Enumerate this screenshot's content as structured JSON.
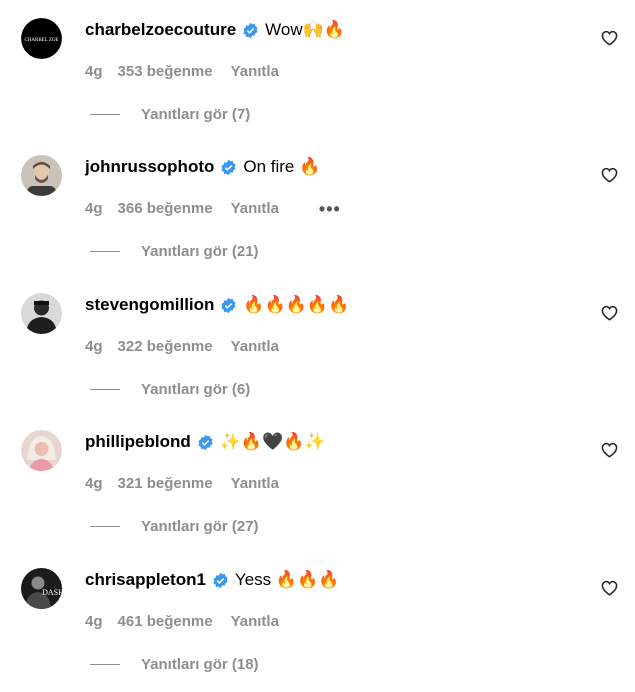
{
  "comments": [
    {
      "username": "charbelzoecouture",
      "text": "Wow🙌🔥",
      "time": "4g",
      "likes": "353 beğenme",
      "reply": "Yanıtla",
      "view_replies": "Yanıtları gör (7)",
      "avatar_text": "CHARBEL ZOE",
      "has_more": false
    },
    {
      "username": "johnrussophoto",
      "text": "On fire 🔥",
      "time": "4g",
      "likes": "366 beğenme",
      "reply": "Yanıtla",
      "view_replies": "Yanıtları gör (21)",
      "has_more": true,
      "more_icon": "•••"
    },
    {
      "username": "stevengomillion",
      "text": "🔥🔥🔥🔥🔥",
      "time": "4g",
      "likes": "322 beğenme",
      "reply": "Yanıtla",
      "view_replies": "Yanıtları gör (6)",
      "has_more": false
    },
    {
      "username": "phillipeblond",
      "text": "✨🔥🖤🔥✨",
      "time": "4g",
      "likes": "321 beğenme",
      "reply": "Yanıtla",
      "view_replies": "Yanıtları gör (27)",
      "has_more": false
    },
    {
      "username": "chrisappleton1",
      "text": "Yess 🔥🔥🔥",
      "time": "4g",
      "likes": "461 beğenme",
      "reply": "Yanıtla",
      "view_replies": "Yanıtları gör (18)",
      "avatar_text": "DASH",
      "has_more": false
    }
  ],
  "icons": {
    "verified": "verified-badge-icon",
    "heart": "heart-outline-icon",
    "more": "more-options-icon"
  },
  "colors": {
    "verified": "#3897f0",
    "muted": "#8e8e8e",
    "text": "#000000"
  }
}
